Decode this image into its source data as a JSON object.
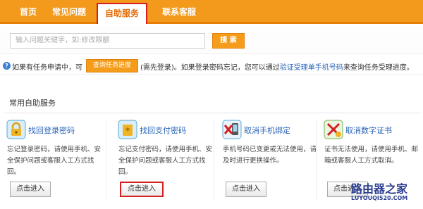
{
  "nav": {
    "items": [
      {
        "label": "首页"
      },
      {
        "label": "常见问题"
      },
      {
        "label": "自助服务"
      },
      {
        "label": "联系客服"
      }
    ]
  },
  "search": {
    "placeholder": "输入问题关键字，如:修改限额",
    "button": "搜 索"
  },
  "info": {
    "prefix": "如果有任务申请中，可",
    "query_button": "查询任务进度",
    "middle": "(需先登录)。如果登录密码忘记，您可以通过",
    "link": "验证受理单手机号码",
    "suffix": "来查询任务受理进度。"
  },
  "section": {
    "title": "常用自助服务"
  },
  "cards": [
    {
      "title": "找回登录密码",
      "icon": "lock-icon",
      "desc": "忘记登录密码，请使用手机、安全保护问题或客服人工方式找回。",
      "button": "点击进入"
    },
    {
      "title": "找回支付密码",
      "icon": "pay-lock-icon",
      "desc": "忘记支付密码，请使用手机、安全保护问题或客服人工方式找回。",
      "button": "点击进入"
    },
    {
      "title": "取消手机绑定",
      "icon": "phone-cancel-icon",
      "desc": "手机号码已变更或无法使用，请及时进行更换操作。",
      "button": "点击进入"
    },
    {
      "title": "取消数字证书",
      "icon": "certificate-cancel-icon",
      "desc": "证书无法使用，请使用手机、邮箱或客服人工方式取消。",
      "button": "点击进入"
    }
  ],
  "watermark": {
    "main": "路由器之家",
    "sub": "LUYOUQI520.COM"
  },
  "colors": {
    "nav": "#f39a1d",
    "accent_red": "#d62020",
    "link": "#2a64b8"
  }
}
